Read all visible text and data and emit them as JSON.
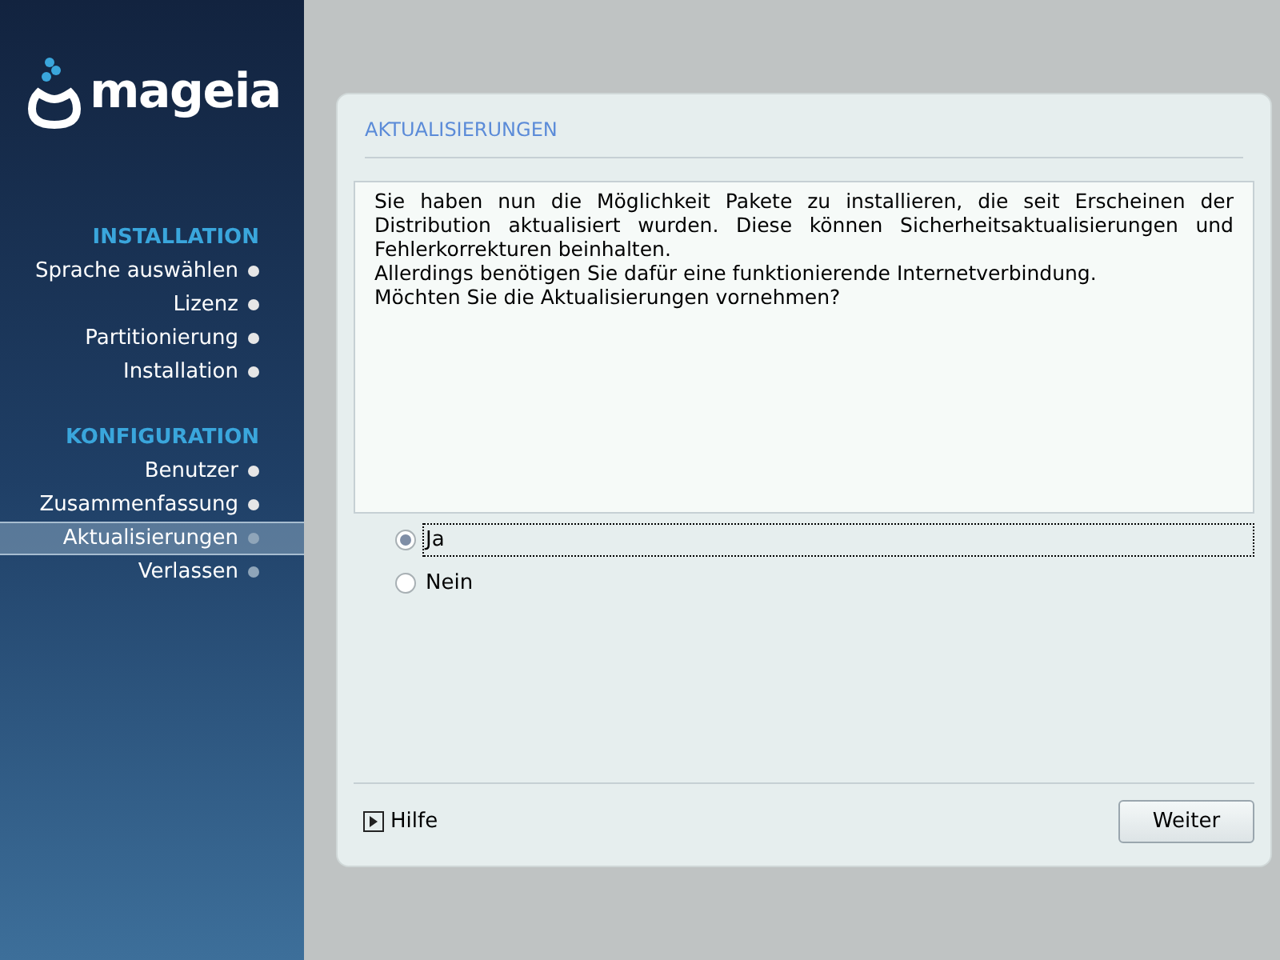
{
  "logo": {
    "text": "mageia"
  },
  "sidebar": {
    "sections": [
      {
        "title": "INSTALLATION",
        "items": [
          {
            "label": "Sprache auswählen",
            "selected": false,
            "done": true
          },
          {
            "label": "Lizenz",
            "selected": false,
            "done": true
          },
          {
            "label": "Partitionierung",
            "selected": false,
            "done": true
          },
          {
            "label": "Installation",
            "selected": false,
            "done": true
          }
        ]
      },
      {
        "title": "KONFIGURATION",
        "items": [
          {
            "label": "Benutzer",
            "selected": false,
            "done": true
          },
          {
            "label": "Zusammenfassung",
            "selected": false,
            "done": true
          },
          {
            "label": "Aktualisierungen",
            "selected": true,
            "done": false
          },
          {
            "label": "Verlassen",
            "selected": false,
            "done": false
          }
        ]
      }
    ]
  },
  "dialog": {
    "title": "AKTUALISIERUNGEN",
    "message": [
      "Sie haben nun die Möglichkeit Pakete zu installieren, die seit Erscheinen der Distribution aktualisiert wurden. Diese können Sicherheitsaktualisierungen und Fehlerkorrekturen beinhalten.",
      "Allerdings benötigen Sie dafür eine funktionierende Internetverbindung.",
      "Möchten Sie die Aktualisierungen vornehmen?"
    ],
    "options": [
      {
        "label": "Ja",
        "selected": true
      },
      {
        "label": "Nein",
        "selected": false
      }
    ],
    "help": "Hilfe",
    "button": "Weiter"
  }
}
